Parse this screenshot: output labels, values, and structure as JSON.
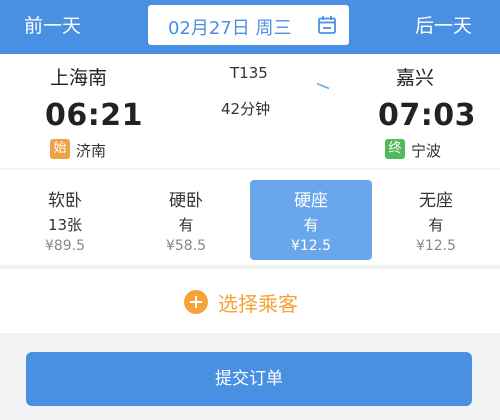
{
  "header": {
    "prev_day": "前一天",
    "next_day": "后一天",
    "date": "02月27日 周三",
    "calendar_icon": "calendar-icon"
  },
  "trip": {
    "from_station": "上海南",
    "to_station": "嘉兴",
    "depart_time": "06:21",
    "arrive_time": "07:03",
    "start_badge": "始",
    "end_badge": "终",
    "origin": "济南",
    "terminus": "宁波",
    "train_no": "T135",
    "duration": "42分钟"
  },
  "seats": [
    {
      "name": "软卧",
      "count": "13张",
      "price": "¥89.5"
    },
    {
      "name": "硬卧",
      "count": "有",
      "price": "¥58.5"
    },
    {
      "name": "硬座",
      "count": "有",
      "price": "¥12.5"
    },
    {
      "name": "无座",
      "count": "有",
      "price": "¥12.5"
    }
  ],
  "passenger": {
    "label": "选择乘客",
    "icon": "plus-circle-icon"
  },
  "submit_label": "提交订单",
  "colors": {
    "primary": "#4a90e2",
    "selected_seat": "#6aa7ea",
    "accent": "#f5a238",
    "start_badge": "#f0a14a",
    "end_badge": "#55b95c"
  }
}
